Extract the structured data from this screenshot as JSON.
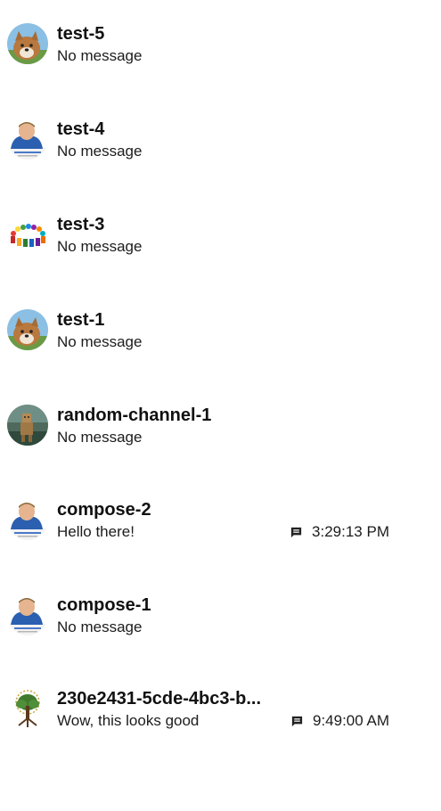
{
  "conversations": [
    {
      "title": "test-5",
      "subtitle": "No message",
      "avatar": "shiba-dog-avatar",
      "timestamp": "",
      "icon": ""
    },
    {
      "title": "test-4",
      "subtitle": "No message",
      "avatar": "person-avatar",
      "timestamp": "",
      "icon": ""
    },
    {
      "title": "test-3",
      "subtitle": "No message",
      "avatar": "group-circle-avatar",
      "timestamp": "",
      "icon": ""
    },
    {
      "title": "test-1",
      "subtitle": "No message",
      "avatar": "shiba-dog-avatar",
      "timestamp": "",
      "icon": ""
    },
    {
      "title": "random-channel-1",
      "subtitle": "No message",
      "avatar": "figure-photo-avatar",
      "timestamp": "",
      "icon": ""
    },
    {
      "title": "compose-2",
      "subtitle": "Hello there!",
      "avatar": "person-avatar",
      "timestamp": "3:29:13 PM",
      "icon": "message-icon"
    },
    {
      "title": "compose-1",
      "subtitle": "No message",
      "avatar": "person-avatar",
      "timestamp": "",
      "icon": ""
    },
    {
      "title": "230e2431-5cde-4bc3-b...",
      "subtitle": "Wow, this looks good",
      "avatar": "tree-logo-avatar",
      "timestamp": "9:49:00 AM",
      "icon": "message-icon"
    }
  ],
  "colors": {
    "background": "#ffffff",
    "title_text": "#111111",
    "subtitle_text": "#1c1c1c"
  }
}
